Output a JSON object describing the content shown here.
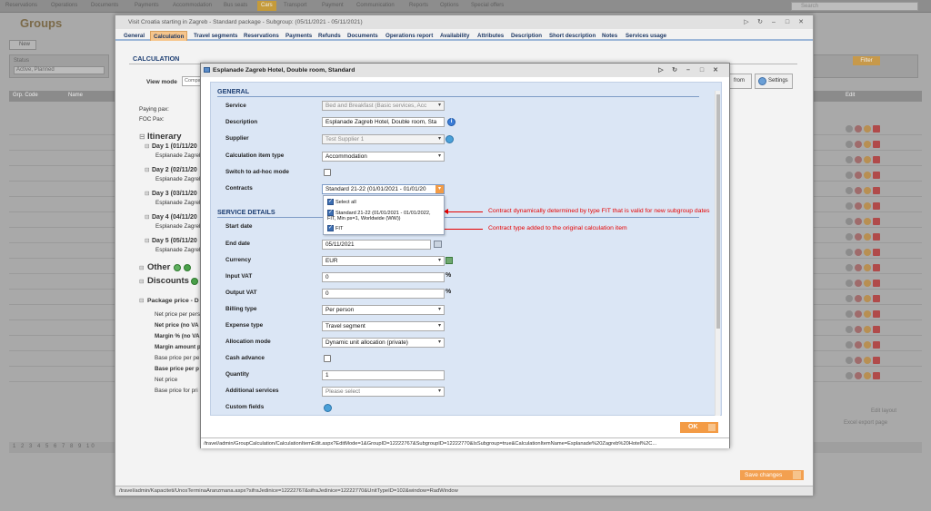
{
  "background": {
    "nav_items": [
      "Reservations",
      "Operations",
      "Documents",
      "Payments",
      "Accommodation",
      "Bus seats",
      "Cars",
      "Transport",
      "Payment",
      "Communication",
      "Reports",
      "Options",
      "Special offers"
    ],
    "active_nav": "Cars",
    "search_placeholder": "Search",
    "page_title": "Groups",
    "new_button": "New",
    "filter_label": "Status",
    "filter_value": "Active, Planned",
    "filter_button": "Filter",
    "grid_headers": [
      "Grp. Code",
      "Name",
      "Edit"
    ],
    "edit_layout": "Edit layout",
    "excel_export": "Excel export page",
    "pager": "1 2 3 4 5 6 7 8 9 10"
  },
  "outer": {
    "title": "Visit Croatia starting in Zagreb - Standard package - Subgroup: (05/11/2021 - 05/11/2021)",
    "tabs": [
      "General",
      "Calculation",
      "Travel segments",
      "Reservations",
      "Payments",
      "Refunds",
      "Documents",
      "Operations report",
      "Availability",
      "Attributes",
      "Description",
      "Short description",
      "Notes",
      "Services usage"
    ],
    "active_tab": "Calculation",
    "section_header": "CALCULATION",
    "view_mode_label": "View mode",
    "view_mode_value": "Compa",
    "from_button": "from",
    "settings_button": "Settings",
    "paying_pax": "Paying pax:",
    "foc_pax": "FOC Pax:",
    "itinerary": "Itinerary",
    "days": [
      {
        "label": "Day 1 (01/11/20",
        "sub": "Esplanade Zagreb"
      },
      {
        "label": "Day 2 (02/11/20",
        "sub": "Esplanade Zagreb"
      },
      {
        "label": "Day 3 (03/11/20",
        "sub": "Esplanade Zagreb"
      },
      {
        "label": "Day 4 (04/11/20",
        "sub": "Esplanade Zagreb"
      },
      {
        "label": "Day 5 (05/11/20",
        "sub": "Esplanade Zagreb"
      }
    ],
    "other": "Other",
    "discounts": "Discounts",
    "package_price": "Package price - D",
    "price_rows": [
      {
        "t": "Net price per pers",
        "b": false
      },
      {
        "t": "Net price (no VA",
        "b": true
      },
      {
        "t": "Margin % (no VA",
        "b": true
      },
      {
        "t": "Margin amount p",
        "b": true
      },
      {
        "t": "Base price per pe",
        "b": false
      },
      {
        "t": "Base price per p",
        "b": true
      },
      {
        "t": "Net price",
        "b": false
      },
      {
        "t": "Base price for pri",
        "b": false
      }
    ],
    "save_changes": "Save changes",
    "status_url": "/travel/admin/Kapaciteti/UnosTerminaAranzmana.aspx?sifraJedinice=12222767&sifraJedinice=12222770&UnitTypeID=102&window=RadWindow"
  },
  "inner": {
    "title": "Esplanade Zagreb Hotel, Double room, Standard",
    "general_header": "GENERAL",
    "service_details_header": "SERVICE DETAILS",
    "fields": {
      "service_label": "Service",
      "service_value": "Bed and Breakfast (Basic services, Acc",
      "description_label": "Description",
      "description_value": "Esplanade Zagreb Hotel, Double room, Sta",
      "supplier_label": "Supplier",
      "supplier_value": "Test Supplier 1",
      "calc_type_label": "Calculation item type",
      "calc_type_value": "Accommodation",
      "adhoc_label": "Switch to ad-hoc mode",
      "contracts_label": "Contracts",
      "contracts_value": "Standard 21-22 (01/01/2021 - 01/01/20",
      "start_date_label": "Start date",
      "end_date_label": "End date",
      "end_date_value": "05/11/2021",
      "currency_label": "Currency",
      "currency_value": "EUR",
      "input_vat_label": "Input VAT",
      "input_vat_value": "0",
      "output_vat_label": "Output VAT",
      "output_vat_value": "0",
      "pct": "%",
      "billing_label": "Billing type",
      "billing_value": "Per person",
      "expense_label": "Expense type",
      "expense_value": "Travel segment",
      "allocation_label": "Allocation mode",
      "allocation_value": "Dynamic unit allocation (private)",
      "cash_label": "Cash advance",
      "quantity_label": "Quantity",
      "quantity_value": "1",
      "additional_label": "Additional services",
      "additional_placeholder": "Please select",
      "custom_label": "Custom fields"
    },
    "dropdown": {
      "select_all": "Select all",
      "item1_line1": "Standard 21-22 (01/01/2021 - 01/01/2022,",
      "item1_line2": "FIT, Min ps=1, Worldwide (WW))",
      "item2": "FIT"
    },
    "ok_button": "OK",
    "status_url": "/travel/admin/GroupCalculation/CalculationItemEdit.aspx?EditMode=1&GroupID=12222767&SubgroupID=12222770&IsSubgroup=true&CalculationItemName=Esplanade%20Zagreb%20Hotel%2C..."
  },
  "annotations": {
    "a1": "Contract dynamically determined by type FIT that is valid for new subgroup dates",
    "a2": "Contract type added to the original calculation item"
  }
}
